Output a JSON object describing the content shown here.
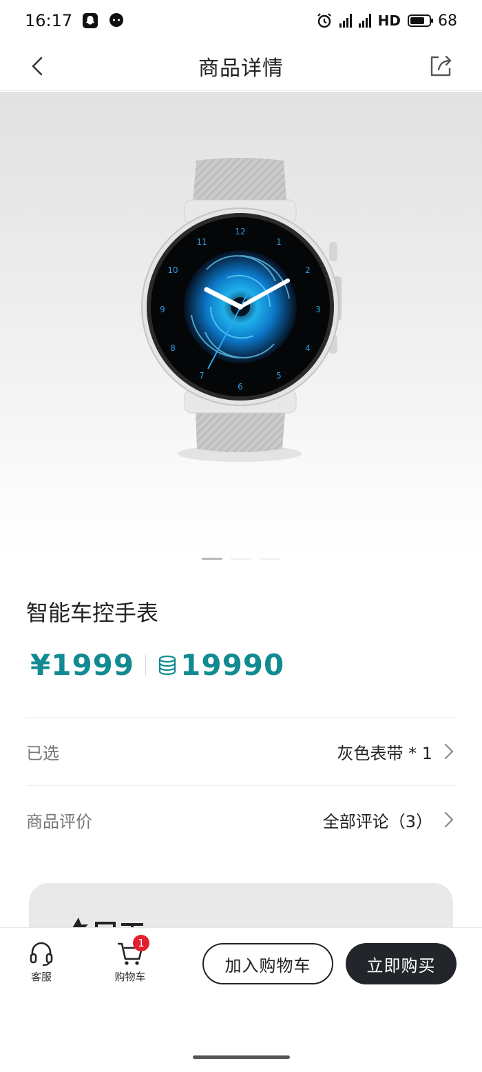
{
  "status_bar": {
    "time": "16:17",
    "battery": "68",
    "network_label": "HD",
    "icons": [
      "qq-icon",
      "wechat-icon",
      "alarm-icon",
      "signal-5g-icon",
      "signal-5g-icon",
      "battery-icon"
    ]
  },
  "nav": {
    "title": "商品详情",
    "back_icon": "chevron-left-icon",
    "share_icon": "share-icon"
  },
  "hero": {
    "image": "smartwatch-photo",
    "watch_numbers": [
      "12",
      "1",
      "2",
      "3",
      "4",
      "5",
      "6",
      "7",
      "8",
      "9",
      "10",
      "11"
    ],
    "carousel_count": 3,
    "carousel_active": 1
  },
  "product": {
    "name": "智能车控手表",
    "price_cny": "¥1999",
    "price_points": "19990",
    "price_color": "#118a92"
  },
  "selected": {
    "label": "已选",
    "value": "灰色表带 * 1"
  },
  "reviews": {
    "label": "商品评价",
    "value": "全部评论（3）"
  },
  "bottom_bar": {
    "service_label": "客服",
    "cart_label": "购物车",
    "cart_badge": "1",
    "add_to_cart": "加入购物车",
    "buy_now": "立即购买",
    "buy_bg": "#22262a",
    "badge_color": "#e5202e"
  }
}
